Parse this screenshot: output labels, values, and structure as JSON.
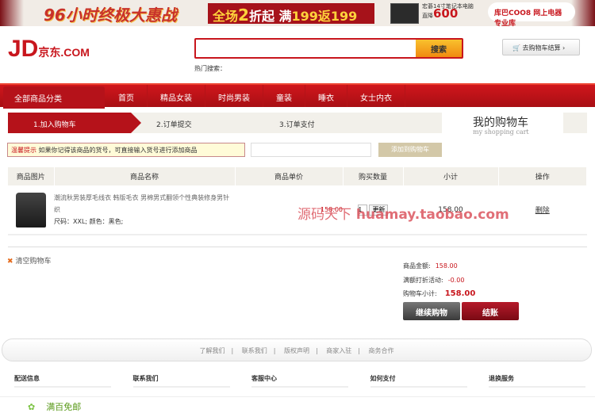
{
  "banner": {
    "promo_title": "96小时终极大惠战",
    "promo_offer_prefix": "全场",
    "promo_offer_num": "2",
    "promo_offer_mid": "折起 满",
    "promo_offer_amount": "199返199",
    "laptop_title": "宏碁14寸笔记本电脑",
    "laptop_drop_label": "直降",
    "laptop_drop_value": "600",
    "partner": "库巴COO8 网上电器专业库"
  },
  "header": {
    "logo": "JD",
    "logo_cn": "京东",
    "logo_com": ".COM",
    "search_placeholder": "",
    "search_button": "搜索",
    "hot_search_label": "热门搜索：",
    "cart_button": "去购物车结算"
  },
  "nav": {
    "all_categories": "全部商品分类",
    "items": [
      "首页",
      "精品女装",
      "时尚男装",
      "童装",
      "睡衣",
      "女士内衣"
    ]
  },
  "steps": [
    "1.加入购物车",
    "2.订单提交",
    "3.订单支付"
  ],
  "cart_title": "我的购物车",
  "cart_subtitle": "my shopping cart",
  "tip": {
    "label": "温馨提示",
    "text": "如果你记得该商品的货号，可直接输入货号进行添加商品",
    "input_value": "",
    "add_button": "添加到购物车"
  },
  "table": {
    "headers": [
      "商品图片",
      "商品名称",
      "商品单价",
      "购买数量",
      "小计",
      "操作"
    ],
    "rows": [
      {
        "name": "潮流秋男装厚毛线衣 韩版毛衣 男棉男式翻领个性典装修身男针织",
        "attrs": "尺码：XXL; 颜色：黑色;",
        "price": "158.00",
        "qty": "1",
        "update": "更新",
        "subtotal": "158.00",
        "action": "删除"
      }
    ]
  },
  "watermark": {
    "cn": "源码天下",
    "url": "huamay.taobao.com"
  },
  "clear_cart": "清空购物车",
  "summary": {
    "goods_label": "商品金额:",
    "goods_value": "158.00",
    "discount_label": "满额打折活动:",
    "discount_value": "-0.00",
    "total_label": "购物车小计:",
    "total_value": "158.00"
  },
  "buttons": {
    "continue": "继续购物",
    "checkout": "结账"
  },
  "footer": {
    "links": [
      "了解我们",
      "联系我们",
      "版权声明",
      "商家入驻",
      "商务合作"
    ],
    "columns": [
      "配送信息",
      "联系我们",
      "客服中心",
      "如何支付",
      "退换服务"
    ],
    "free_shipping": "满百免邮"
  }
}
